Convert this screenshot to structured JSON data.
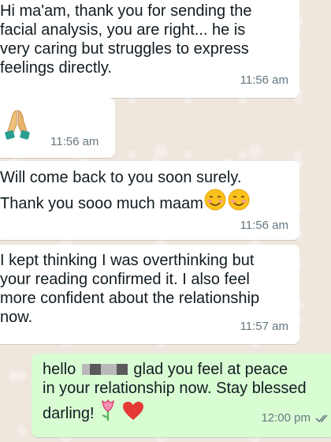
{
  "messages": [
    {
      "id": "m1",
      "direction": "incoming",
      "text": "Hi ma'am, thank you for sending the\nfacial analysis, you are right... he is\nvery caring but struggles to express\nfeelings directly.",
      "time": "11:56 am"
    },
    {
      "id": "m2",
      "direction": "incoming",
      "emoji": "folded-hands",
      "time": "11:56 am"
    },
    {
      "id": "m3",
      "direction": "incoming",
      "line1": "Will come back to you soon surely.",
      "line2": "Thank you sooo much maam",
      "emoji": "smiling-face-with-blushing-cheeks x2",
      "time": "11:56 am"
    },
    {
      "id": "m4",
      "direction": "incoming",
      "text": "I kept thinking I was overthinking but\nyour reading confirmed it. I also feel\nmore confident about the relationship\nnow.",
      "time": "11:57 am"
    },
    {
      "id": "m5",
      "direction": "outgoing",
      "greeting": "hello",
      "after_redaction": "glad you feel at peace",
      "line2": "in your relationship now. Stay blessed",
      "line3": "darling!",
      "emoji": "tulip, red-heart",
      "time": "12:00 pm",
      "status": "read-double-check"
    }
  ],
  "colors": {
    "incoming_bubble": "#ffffff",
    "outgoing_bubble": "#d9fdd3",
    "timestamp": "#667781",
    "read_check": "#667781"
  }
}
